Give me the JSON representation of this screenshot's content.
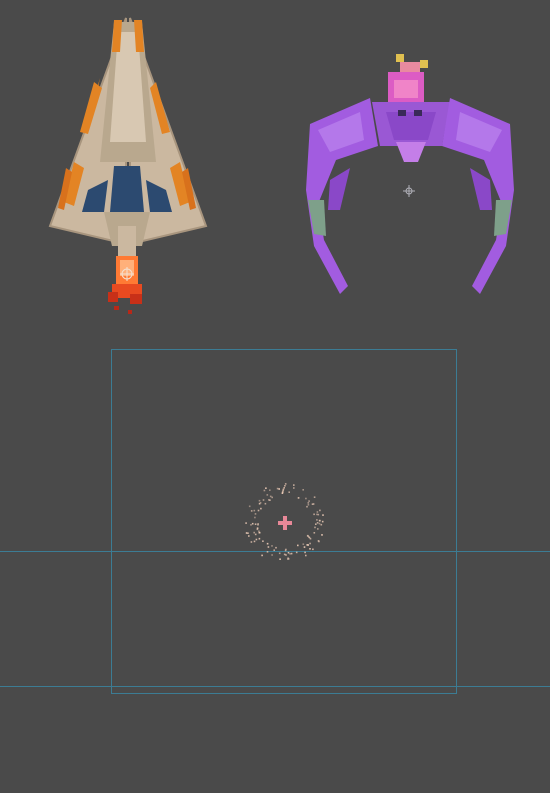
{
  "scene": {
    "background": "#4a4a4a",
    "guide_color": "#3c7c94"
  },
  "sprites": [
    {
      "name": "player-ship",
      "icon": "triangular-spaceship",
      "colors": {
        "hull": "#cbb8a0",
        "stripes": "#e38424",
        "cockpit": "#2c4a70",
        "thrust": "#ff6a2a"
      }
    },
    {
      "name": "enemy-crab-ship",
      "icon": "purple-claw-alien",
      "colors": {
        "body": "#a25ce0",
        "core": "#dc5cc4",
        "accent": "#e0c050",
        "claw_tip": "#7ea08a"
      }
    }
  ],
  "particle_emitter": {
    "name": "explosion-particle-ring",
    "color": "#e8c8b4",
    "pivot_color": "#e88898"
  }
}
